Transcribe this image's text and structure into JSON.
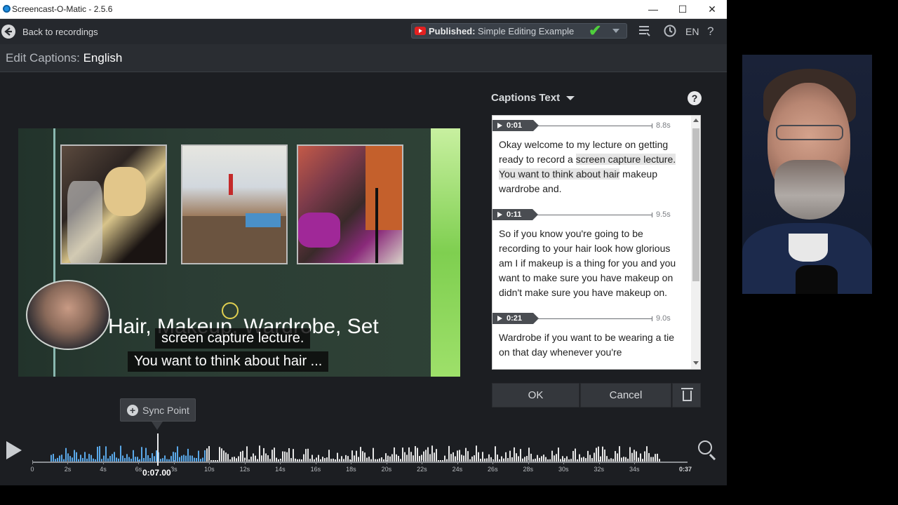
{
  "window": {
    "title": "Screencast-O-Matic - 2.5.6",
    "minimize": "—",
    "maximize": "☐",
    "close": "✕"
  },
  "topbar": {
    "back_label": "Back to recordings",
    "back_icon": "←",
    "publish_state": "Published:",
    "publish_title": "Simple Editing Example",
    "check": "✔",
    "notes_icon": "☰",
    "history_icon": "⟲",
    "language": "EN",
    "help": "?"
  },
  "editor": {
    "label": "Edit Captions:",
    "language": "English"
  },
  "video": {
    "slide_title": "Hair, Makeup, Wardrobe, Set",
    "caption_lines": [
      "screen capture lecture.",
      "You want to think about hair ..."
    ]
  },
  "captions_panel": {
    "title": "Captions Text",
    "help": "?",
    "segments": [
      {
        "start": "0:01",
        "duration": "8.8s",
        "text_before": "Okay welcome to my lecture on getting ready to record a ",
        "text_highlight": "screen capture lecture. You want to think about hair",
        "text_after": " makeup wardrobe and."
      },
      {
        "start": "0:11",
        "duration": "9.5s",
        "text": "So if you know you're going to be recording to your hair look how glorious am I if makeup is a thing for you and you want to make sure you have makeup on didn't make sure you have makeup on."
      },
      {
        "start": "0:21",
        "duration": "9.0s",
        "text": "Wardrobe if you want to be wearing a tie on that day whenever you're"
      }
    ],
    "ok_label": "OK",
    "cancel_label": "Cancel",
    "delete_icon": "trash-icon"
  },
  "timeline": {
    "sync_label": "Sync Point",
    "sync_plus": "+",
    "current_time": "0:07.00",
    "end_time": "0:37",
    "tick_labels": [
      "0",
      "2s",
      "4s",
      "6s",
      "8s",
      "10s",
      "12s",
      "14s",
      "16s",
      "18s",
      "20s",
      "22s",
      "24s",
      "26s",
      "28s",
      "30s",
      "32s",
      "34s"
    ],
    "position_seconds": 7,
    "total_seconds": 37
  },
  "colors": {
    "waveform_played": "#5aa8e8",
    "waveform_unplayed": "#e6e6e6",
    "accent_check": "#4fcf3c",
    "youtube": "#e32121"
  }
}
